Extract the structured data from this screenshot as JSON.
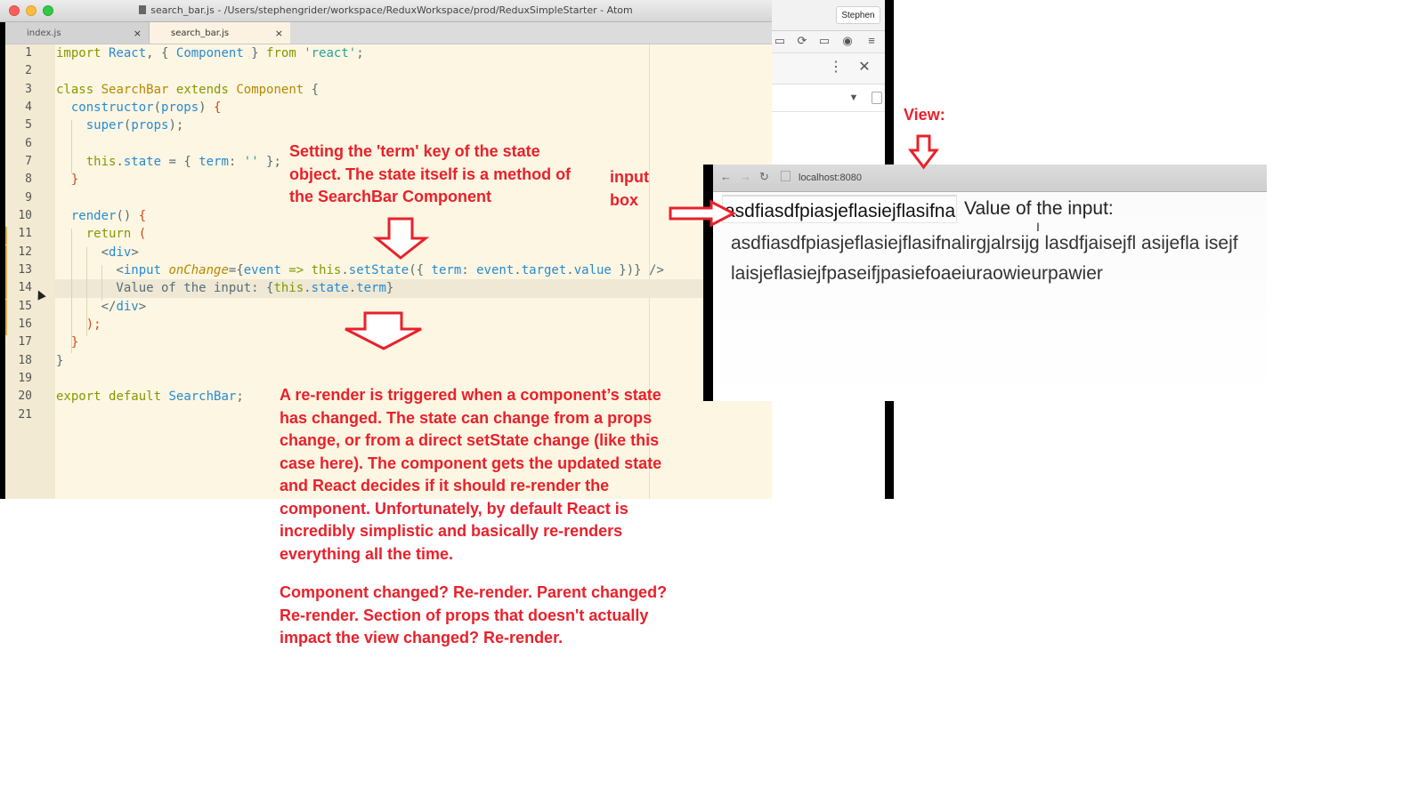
{
  "window": {
    "title": "search_bar.js - /Users/stephengrider/workspace/ReduxWorkspace/prod/ReduxSimpleStarter - Atom"
  },
  "tabs": [
    {
      "label": "index.js",
      "close": "×"
    },
    {
      "label": "search_bar.js",
      "close": "×"
    }
  ],
  "line_numbers": [
    "1",
    "2",
    "3",
    "4",
    "5",
    "6",
    "7",
    "8",
    "9",
    "10",
    "11",
    "12",
    "13",
    "14",
    "15",
    "16",
    "17",
    "18",
    "19",
    "20",
    "21"
  ],
  "code_lines": [
    "import React, { Component } from 'react';",
    "",
    "class SearchBar extends Component {",
    "  constructor(props) {",
    "    super(props);",
    "",
    "    this.state = { term: '' };",
    "  }",
    "",
    "  render() {",
    "    return (",
    "      <div>",
    "        <input onChange={event => this.setState({ term: event.target.value })} />",
    "        Value of the input: {this.state.term}",
    "      </div>",
    "    );",
    "  }",
    "}",
    "",
    "export default SearchBar;",
    ""
  ],
  "chrome": {
    "user": "Stephen"
  },
  "browser": {
    "url": "localhost:8080",
    "input_value": "asdfiasdfpiasjeflasiejflasifnalirgjalrsijg lasdfjaisejfl asijefla isejf laisjeflasiejfpaseifjpasiefoaeiuraowieurpawier",
    "value_label": "Value of the input:",
    "value_text": "asdfiasdfpiasjeflasiejflasifnalirgjalrsijg lasdfjaisejfl asijefla isejf laisjeflasiejfpaseifjpasiefoaeiuraowieurpawier"
  },
  "annotations": {
    "state_note": "Setting the 'term' key of the state object. The state itself is a method of the SearchBar Component",
    "rerender_note_1": "A re-render is triggered when a component’s state has changed. The state can change from a props change, or from a direct setState change (like this case here). The component gets the updated state and React decides if it should re-render the component. Unfortunately, by default React is incredibly simplistic and basically re-renders everything all the time.",
    "rerender_note_2": "Component changed? Re-render. Parent changed? Re-render. Section of props that doesn't actually impact the view changed? Re-render.",
    "input_box": "input box",
    "view": "View:"
  },
  "colors": {
    "annotation": "#e8212b",
    "editor_bg": "#fdf6e3",
    "keyword": "#859900",
    "class": "#b58900",
    "string": "#2aa198",
    "function": "#268bd2"
  }
}
